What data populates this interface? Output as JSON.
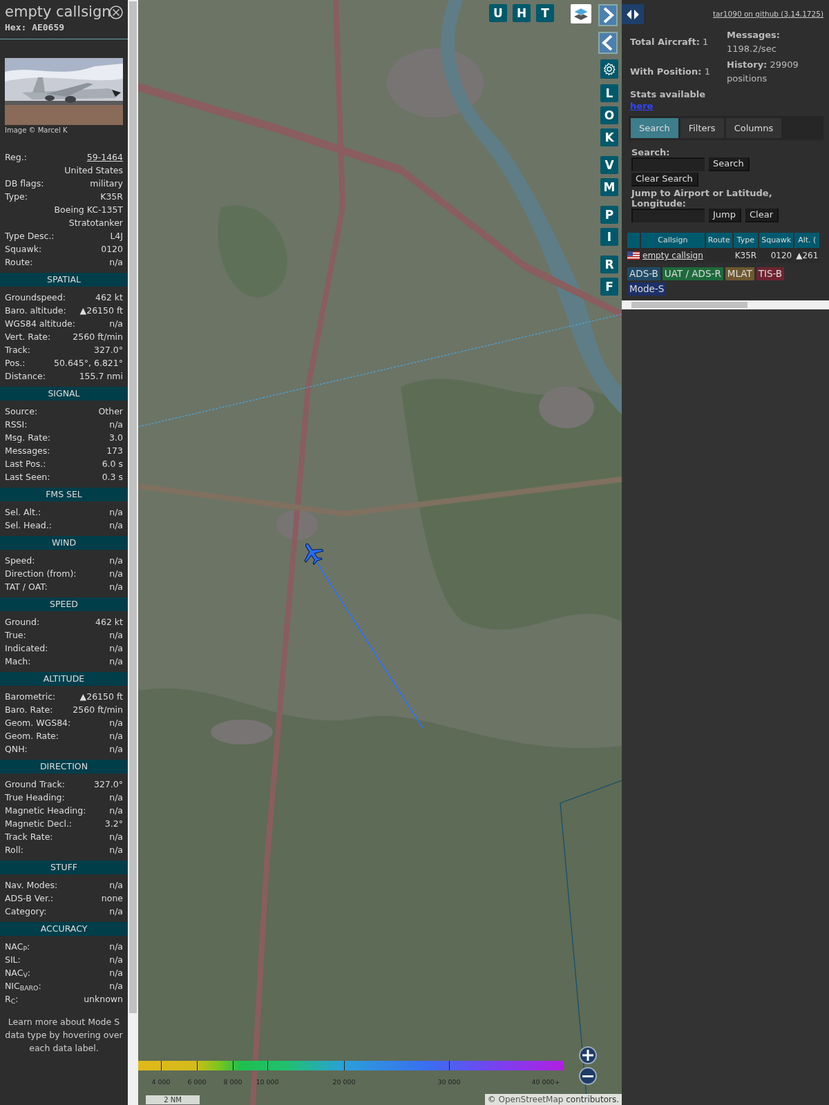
{
  "aircraft": {
    "callsign": "empty callsign",
    "hex": "Hex: AE0659",
    "photo_credit": "Image © Marcel K"
  },
  "info_rows": [
    {
      "label": "Reg.:",
      "value": "59-1464",
      "kind": "link"
    },
    {
      "value": "United States"
    },
    {
      "label": "DB flags:",
      "value": "military"
    },
    {
      "label": "Type:",
      "value": "K35R"
    },
    {
      "value": "Boeing KC-135T Stratotanker"
    },
    {
      "label": "Type Desc.:",
      "value": "L4J"
    },
    {
      "label": "Squawk:",
      "value": "0120"
    },
    {
      "label": "Route:",
      "value": "n/a"
    }
  ],
  "sections": [
    {
      "title": "SPATIAL",
      "rows": [
        {
          "label": "Groundspeed:",
          "value": "462 kt"
        },
        {
          "label": "Baro. altitude:",
          "value": "▲26150 ft"
        },
        {
          "label": "WGS84 altitude:",
          "value": "n/a"
        },
        {
          "label": "Vert. Rate:",
          "value": "2560 ft/min"
        },
        {
          "label": "Track:",
          "value": "327.0°"
        },
        {
          "label": "Pos.:",
          "value": "50.645°, 6.821°"
        },
        {
          "label": "Distance:",
          "value": "155.7 nmi"
        }
      ]
    },
    {
      "title": "SIGNAL",
      "rows": [
        {
          "label": "Source:",
          "value": "Other"
        },
        {
          "label": "RSSI:",
          "value": "n/a"
        },
        {
          "label": "Msg. Rate:",
          "value": "3.0"
        },
        {
          "label": "Messages:",
          "value": "173"
        },
        {
          "label": "Last Pos.:",
          "value": "6.0 s"
        },
        {
          "label": "Last Seen:",
          "value": "0.3 s"
        }
      ]
    },
    {
      "title": "FMS SEL",
      "rows": [
        {
          "label": "Sel. Alt.:",
          "value": "n/a"
        },
        {
          "label": "Sel. Head.:",
          "value": "n/a"
        }
      ]
    },
    {
      "title": "WIND",
      "rows": [
        {
          "label": "Speed:",
          "value": "n/a"
        },
        {
          "label": "Direction (from):",
          "value": "n/a"
        },
        {
          "label": "TAT / OAT:",
          "value": "n/a"
        }
      ]
    },
    {
      "title": "SPEED",
      "rows": [
        {
          "label": "Ground:",
          "value": "462 kt"
        },
        {
          "label": "True:",
          "value": "n/a"
        },
        {
          "label": "Indicated:",
          "value": "n/a"
        },
        {
          "label": "Mach:",
          "value": "n/a"
        }
      ]
    },
    {
      "title": "ALTITUDE",
      "rows": [
        {
          "label": "Barometric:",
          "value": "▲26150 ft"
        },
        {
          "label": "Baro. Rate:",
          "value": "2560 ft/min"
        },
        {
          "label": "Geom. WGS84:",
          "value": "n/a"
        },
        {
          "label": "Geom. Rate:",
          "value": "n/a"
        },
        {
          "label": "QNH:",
          "value": "n/a"
        }
      ]
    },
    {
      "title": "DIRECTION",
      "rows": [
        {
          "label": "Ground Track:",
          "value": "327.0°"
        },
        {
          "label": "True Heading:",
          "value": "n/a"
        },
        {
          "label": "Magnetic Heading:",
          "value": "n/a"
        },
        {
          "label": "Magnetic Decl.:",
          "value": "3.2°"
        },
        {
          "label": "Track Rate:",
          "value": "n/a"
        },
        {
          "label": "Roll:",
          "value": "n/a"
        }
      ]
    },
    {
      "title": "STUFF",
      "rows": [
        {
          "label": "Nav. Modes:",
          "value": "n/a"
        },
        {
          "label": "ADS-B Ver.:",
          "value": "none"
        },
        {
          "label": "Category:",
          "value": "n/a"
        }
      ]
    },
    {
      "title": "ACCURACY",
      "rows": [
        {
          "label": "NAC$_{P}$:",
          "value": "n/a"
        },
        {
          "label": "SIL:",
          "value": "n/a"
        },
        {
          "label": "NAC$_{V}$:",
          "value": "n/a"
        },
        {
          "label": "NIC$_{BARO}$:",
          "value": "n/a"
        },
        {
          "label": "R$_{C}$:",
          "value": "unknown"
        }
      ]
    }
  ],
  "footer_note": "Learn more about Mode S data type by hovering over each data label.",
  "map": {
    "top_buttons": [
      "U",
      "H",
      "T"
    ],
    "side_buttons": [
      [
        "L",
        "O",
        "K"
      ],
      [
        "V",
        "M"
      ],
      [
        "P",
        "I"
      ],
      [
        "R",
        "F"
      ]
    ],
    "altitude_legend": [
      "4 000",
      "6 000",
      "8 000",
      "10 000",
      "20 000",
      "30 000",
      "40 000+"
    ],
    "scale": "2 NM",
    "attribution": {
      "prefix": "©",
      "link": "OpenStreetMap",
      "suffix": "contributors."
    }
  },
  "github_link": "tar1090 on github (3.14.1725)",
  "stats": [
    {
      "label": "Total Aircraft:",
      "value": "1"
    },
    {
      "label": "Messages:",
      "value": "1198.2/sec"
    },
    {
      "label": "With Position:",
      "value": "1"
    },
    {
      "label": "History:",
      "value": "29909 positions"
    }
  ],
  "stats_link": {
    "text": "Stats available",
    "link": "here"
  },
  "tabs": [
    {
      "label": "Search",
      "selected": true
    },
    {
      "label": "Filters",
      "selected": false
    },
    {
      "label": "Columns",
      "selected": false
    }
  ],
  "search": {
    "label": "Search:",
    "buttons": [
      "Search",
      "Clear Search"
    ]
  },
  "jump": {
    "label": "Jump to Airport or Latitude, Longitude:",
    "buttons": [
      "Jump",
      "Clear"
    ]
  },
  "table": {
    "columns": [
      "Callsign",
      "Route",
      "Type",
      "Squawk",
      "Alt. ("
    ],
    "rows": [
      {
        "callsign": "empty callsign",
        "type": "K35R",
        "squawk": "0120",
        "altitude": "▲261"
      }
    ]
  },
  "sources": [
    {
      "label": "ADS-B",
      "color": "#1f4a66"
    },
    {
      "label": "UAT / ADS-R",
      "color": "#1e6a3c"
    },
    {
      "label": "MLAT",
      "color": "#6e5830"
    },
    {
      "label": "TIS-B",
      "color": "#6e2430"
    },
    {
      "label": "Mode-S",
      "color": "#1d3068"
    }
  ]
}
